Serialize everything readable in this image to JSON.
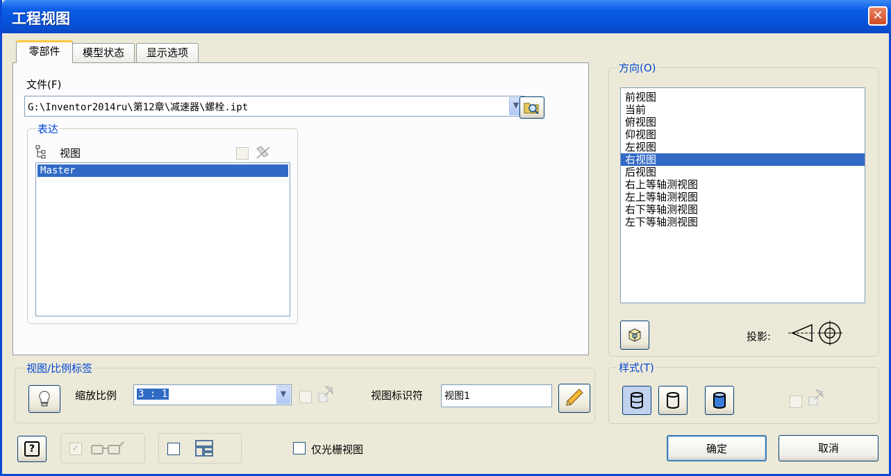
{
  "window": {
    "title": "工程视图",
    "close_symbol": "✕"
  },
  "tabs": [
    {
      "label": "零部件"
    },
    {
      "label": "模型状态"
    },
    {
      "label": "显示选项"
    }
  ],
  "component": {
    "file_label": "文件(F)",
    "file_path": "G:\\Inventor2014ru\\第12章\\减速器\\螺栓.ipt",
    "representation": {
      "group_label": "表达",
      "view_label": "视图",
      "items": [
        "Master"
      ],
      "selected_index": 0
    }
  },
  "view_scale": {
    "group_label": "视图/比例标签",
    "scale_label": "缩放比例",
    "scale_value": "3 : 1",
    "identifier_label": "视图标识符",
    "identifier_value": "视图1"
  },
  "orientation": {
    "group_label": "方向(O)",
    "items": [
      "前视图",
      "当前",
      "俯视图",
      "仰视图",
      "左视图",
      "右视图",
      "后视图",
      "右上等轴测视图",
      "左上等轴测视图",
      "右下等轴测视图",
      "左下等轴测视图"
    ],
    "selected_index": 5,
    "projection_label": "投影:"
  },
  "style": {
    "group_label": "样式(T)"
  },
  "bottom": {
    "raster_label": "仅光栅视图",
    "ok_label": "确定",
    "cancel_label": "取消",
    "help_symbol": "?"
  },
  "colors": {
    "accent": "#0046d5",
    "selection": "#316ac5",
    "titlebar": "#0552d7",
    "close": "#d14a22"
  }
}
